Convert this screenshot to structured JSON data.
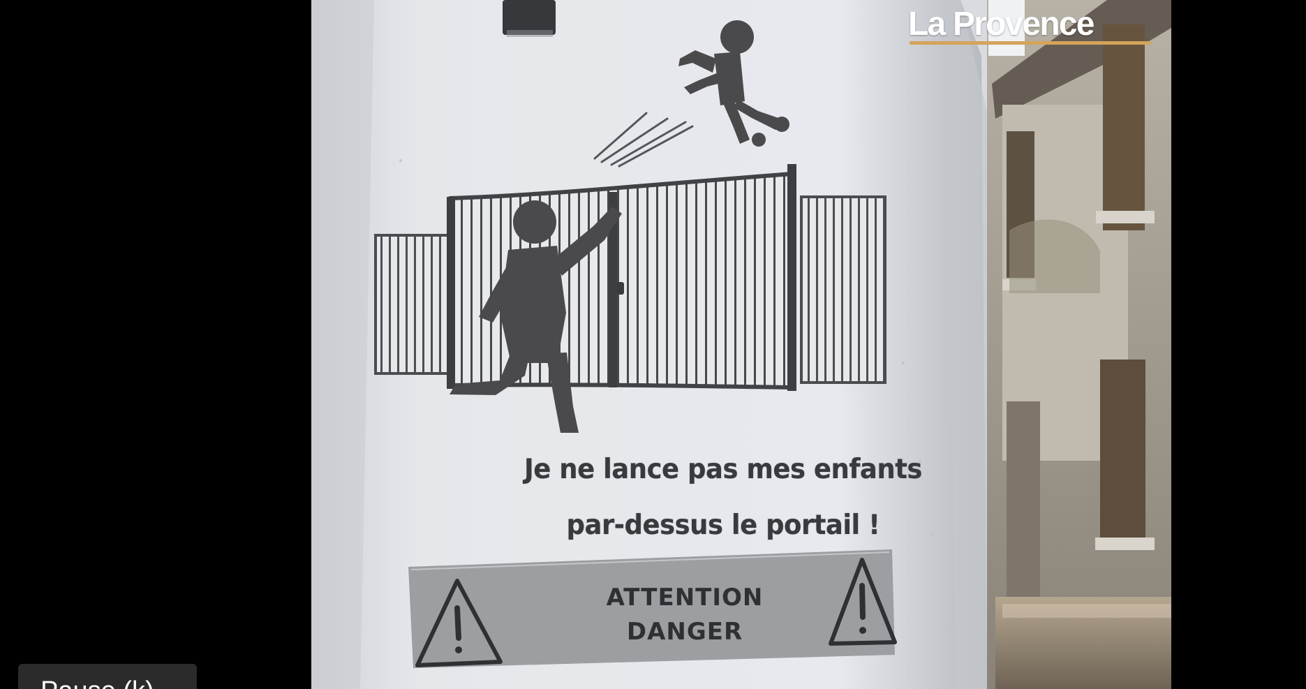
{
  "video": {
    "brand_logo": "La Provence",
    "poster_line1": "Je ne lance pas mes enfants",
    "poster_line2": "par-dessus le portail !",
    "danger_line1": "ATTENTION",
    "danger_line2": "DANGER",
    "warning_icon": "warning-triangle-icon"
  },
  "controls": {
    "pause_tooltip": "Pause (k)"
  },
  "colors": {
    "background": "#000000",
    "brand_accent": "#d5a35b",
    "poster_paper": "#e3e5ea",
    "tooltip_background": "#2b2b2b"
  }
}
